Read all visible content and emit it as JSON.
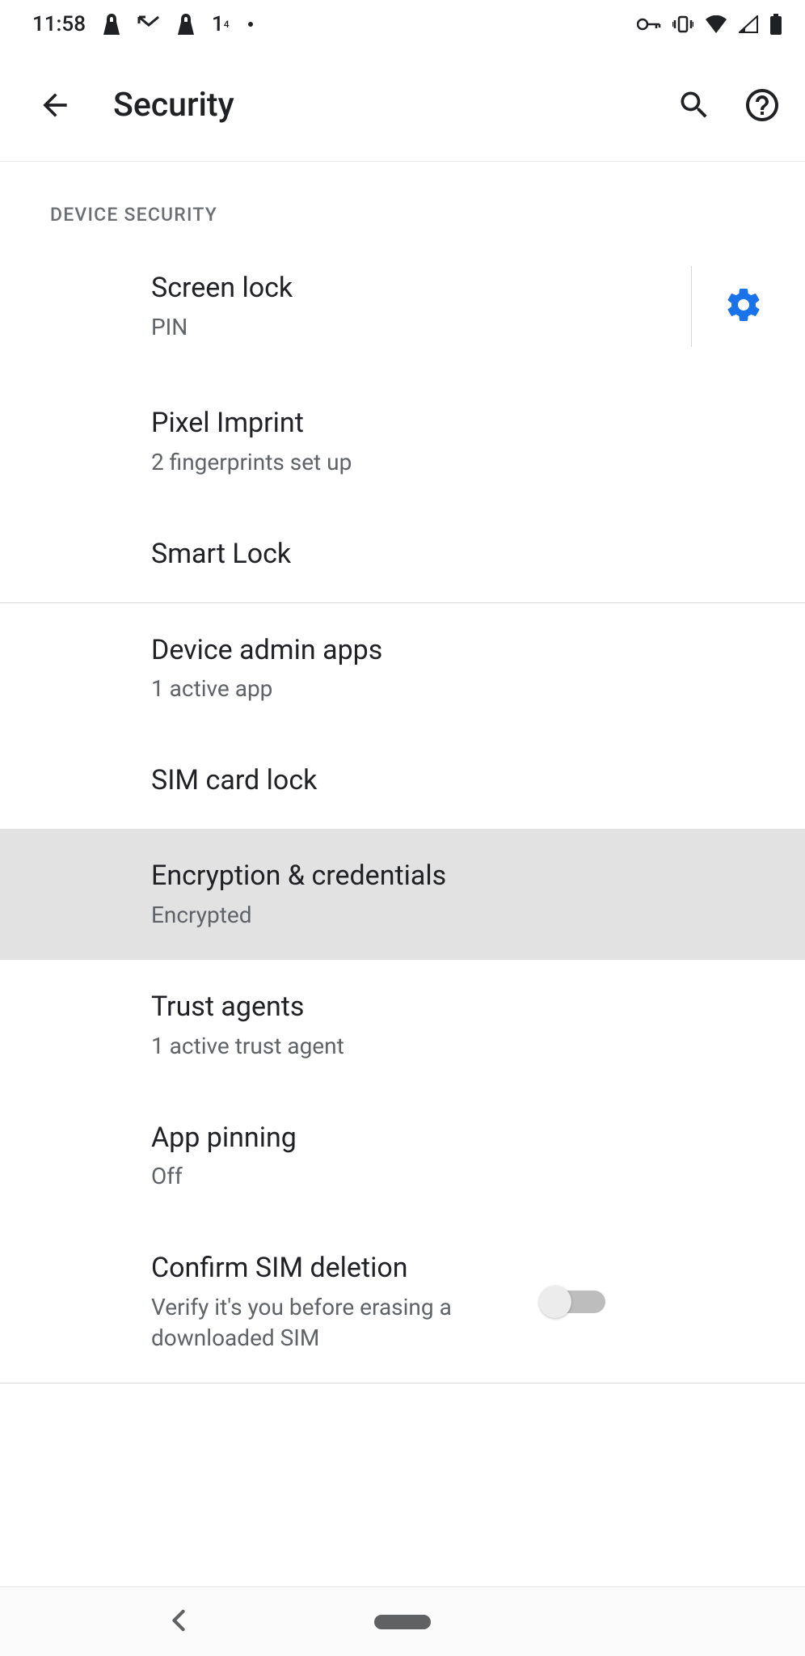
{
  "status": {
    "time": "11:58"
  },
  "header": {
    "title": "Security"
  },
  "section": {
    "header": "DEVICE SECURITY"
  },
  "items": [
    {
      "title": "Screen lock",
      "subtitle": "PIN"
    },
    {
      "title": "Pixel Imprint",
      "subtitle": "2 fingerprints set up"
    },
    {
      "title": "Smart Lock",
      "subtitle": ""
    },
    {
      "title": "Device admin apps",
      "subtitle": "1 active app"
    },
    {
      "title": "SIM card lock",
      "subtitle": ""
    },
    {
      "title": "Encryption & credentials",
      "subtitle": "Encrypted"
    },
    {
      "title": "Trust agents",
      "subtitle": "1 active trust agent"
    },
    {
      "title": "App pinning",
      "subtitle": "Off"
    },
    {
      "title": "Confirm SIM deletion",
      "subtitle": "Verify it's you before erasing a downloaded SIM"
    }
  ]
}
